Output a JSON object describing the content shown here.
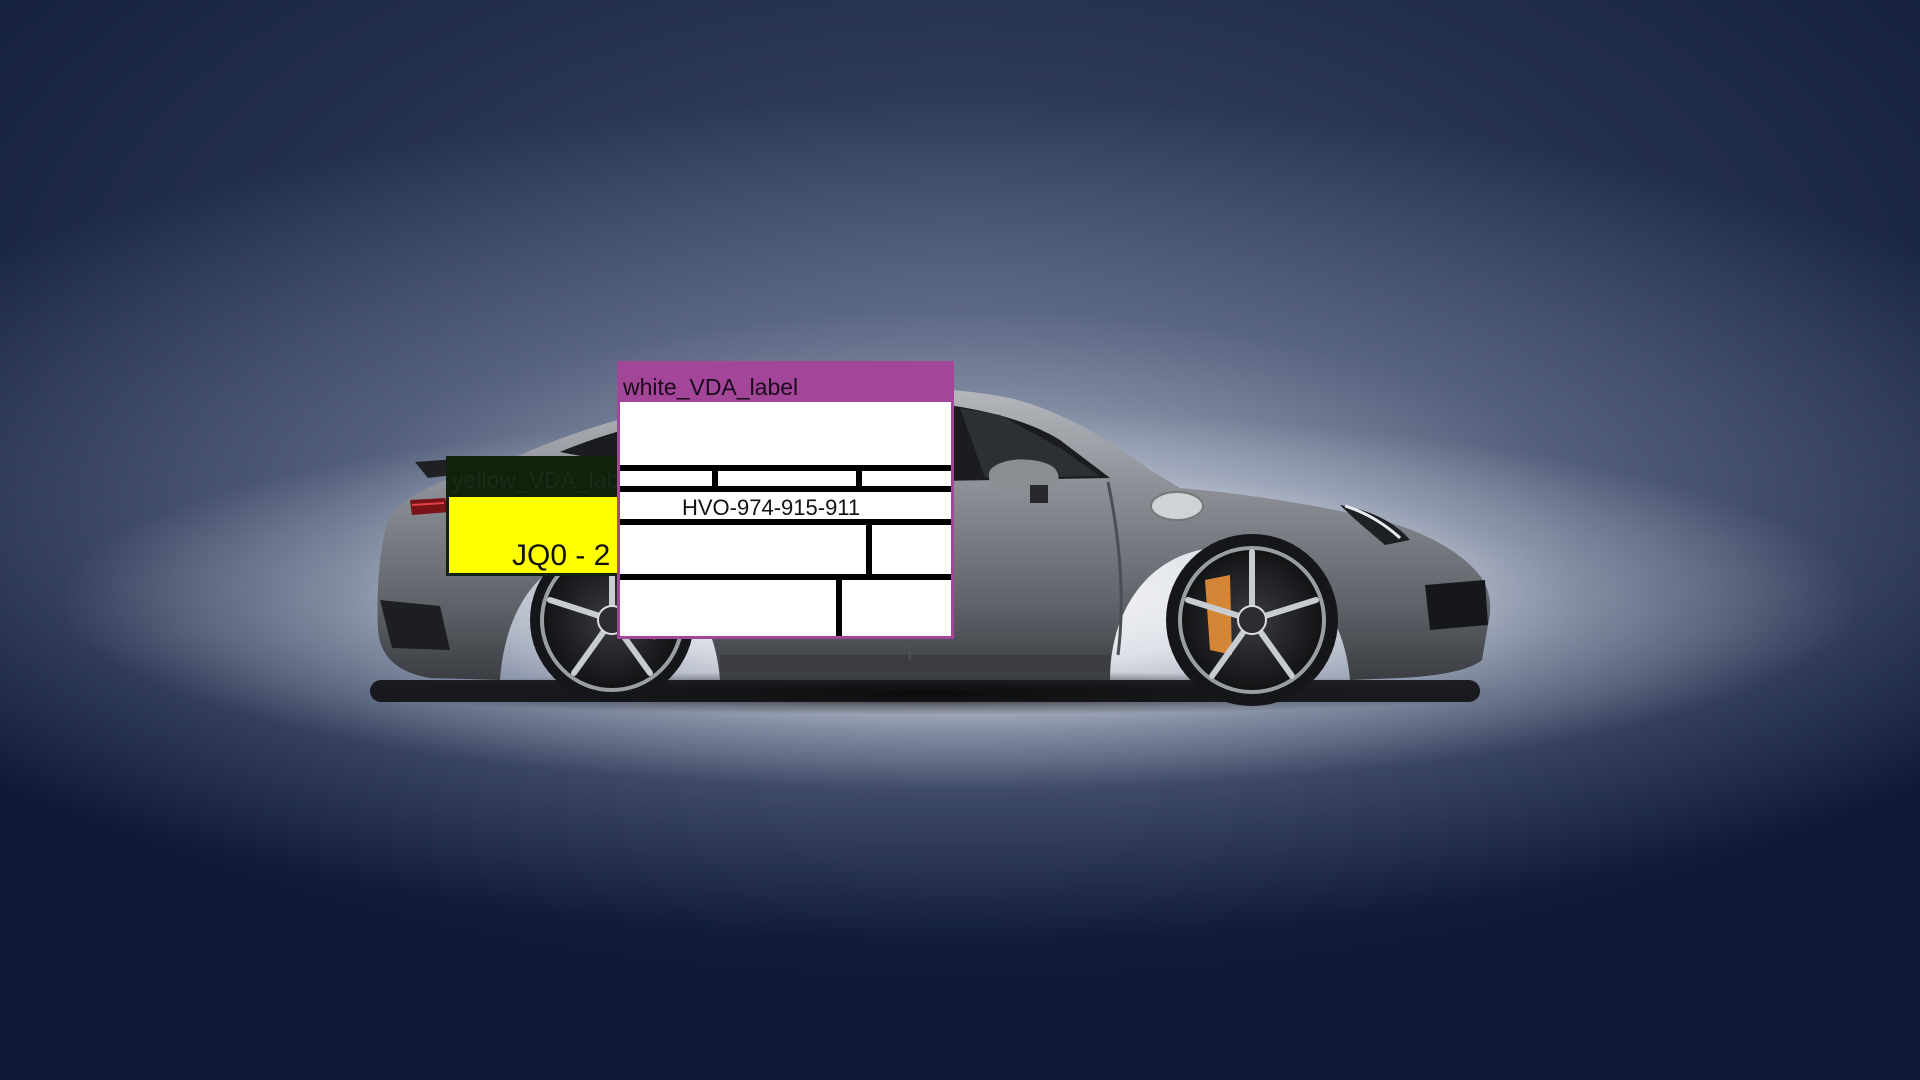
{
  "labels": {
    "yellow": {
      "title": "yellow_VDA_lab",
      "code": "JQ0 - 2",
      "fill_color": "#ffff00",
      "title_color": "#0e2309"
    },
    "white": {
      "title": "white_VDA_label",
      "serial": "HVO-974-915-911",
      "fill_color": "#ffffff",
      "title_color": "#a3469a"
    }
  },
  "scene": {
    "background_color": "#0c1834",
    "subject": "car-icon"
  }
}
